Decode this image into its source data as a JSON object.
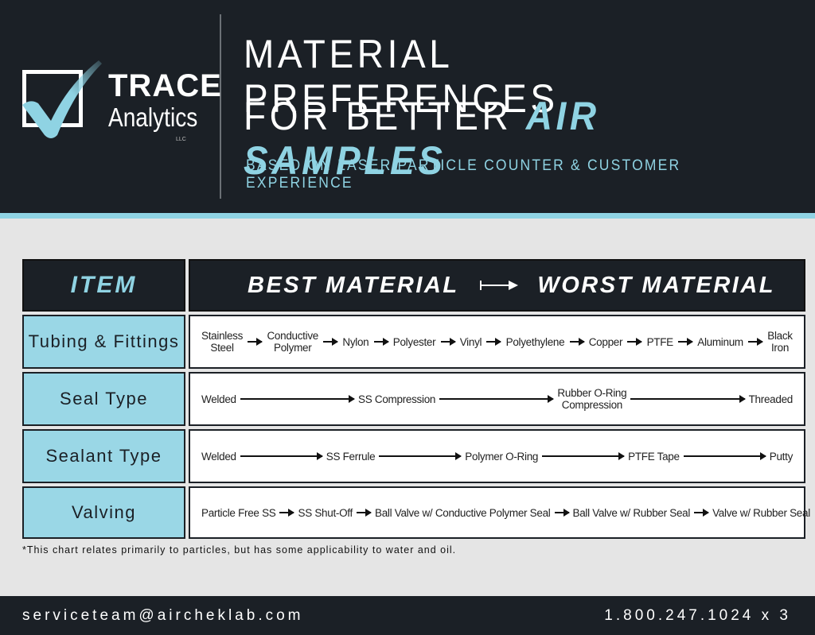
{
  "logo": {
    "brand": "TRACE",
    "sub": "Analytics",
    "suffix": "LLC"
  },
  "title": {
    "line1": "MATERIAL PREFERENCES",
    "line2_prefix": "FOR BETTER ",
    "line2_accent": "AIR SAMPLES",
    "subtitle": "BASED ON LASER PARTICLE COUNTER & CUSTOMER EXPERIENCE"
  },
  "colors": {
    "dark": "#1b2026",
    "accent": "#8fd3e3",
    "label_bg": "#9ad7e6",
    "page_bg": "#e5e5e5"
  },
  "table": {
    "header_item": "ITEM",
    "header_best": "BEST MATERIAL",
    "header_worst": "WORST MATERIAL",
    "rows": [
      {
        "label": "Tubing & Fittings",
        "items": [
          "Stainless\nSteel",
          "Conductive\nPolymer",
          "Nylon",
          "Polyester",
          "Vinyl",
          "Polyethylene",
          "Copper",
          "PTFE",
          "Aluminum",
          "Black\nIron"
        ]
      },
      {
        "label": "Seal Type",
        "items": [
          "Welded",
          "SS Compression",
          "Rubber O-Ring\nCompression",
          "Threaded"
        ]
      },
      {
        "label": "Sealant Type",
        "items": [
          "Welded",
          "SS Ferrule",
          "Polymer O-Ring",
          "PTFE Tape",
          "Putty"
        ]
      },
      {
        "label": "Valving",
        "items": [
          "Particle Free SS",
          "SS Shut-Off",
          "Ball Valve w/ Conductive Polymer Seal",
          "Ball Valve w/ Rubber Seal",
          "Valve w/ Rubber Seal"
        ]
      }
    ]
  },
  "footnote": "*This chart relates primarily to particles, but has some applicability to water and oil.",
  "footer": {
    "email": "serviceteam@aircheklab.com",
    "phone": "1.800.247.1024 x 3"
  }
}
